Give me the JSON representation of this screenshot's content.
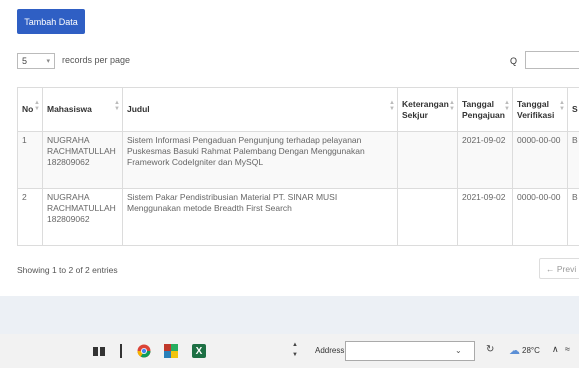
{
  "toolbar": {
    "add_label": "Tambah Data"
  },
  "length": {
    "value": "5",
    "label": "records per page"
  },
  "search": {
    "icon_text": "Q"
  },
  "table": {
    "columns": [
      "No",
      "Mahasiswa",
      "Judul",
      "Keterangan Sekjur",
      "Tanggal Pengajuan",
      "Tanggal Verifikasi",
      "S"
    ],
    "rows": [
      {
        "no": "1",
        "mahasiswa": "NUGRAHA RACHMATULLAH 182809062",
        "judul": "Sistem Informasi Pengaduan Pengunjung terhadap pelayanan Puskesmas Basuki Rahmat Palembang Dengan Menggunakan Framework CodeIgniter dan MySQL",
        "keterangan": "",
        "tgl_pengajuan": "2021-09-02",
        "tgl_verifikasi": "0000-00-00",
        "s": "B"
      },
      {
        "no": "2",
        "mahasiswa": "NUGRAHA RACHMATULLAH 182809062",
        "judul": "Sistem Pakar Pendistribusian Material PT. SINAR MUSI Menggunakan metode Breadth First Search",
        "keterangan": "",
        "tgl_pengajuan": "2021-09-02",
        "tgl_verifikasi": "0000-00-00",
        "s": "B"
      }
    ]
  },
  "info": {
    "text": "Showing 1 to 2 of 2 entries"
  },
  "pagination": {
    "previous_label": "← Previ"
  },
  "taskbar": {
    "address_label": "Address",
    "temperature": "28°C",
    "excel_letter": "X"
  }
}
